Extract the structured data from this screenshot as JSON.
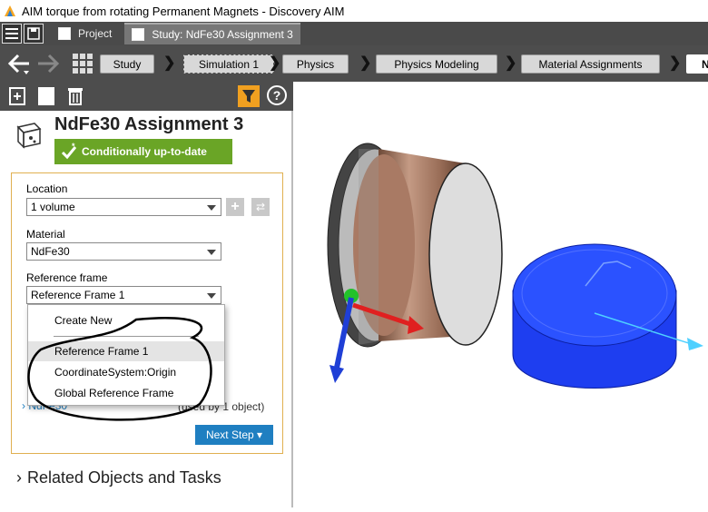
{
  "window": {
    "title": "AIM torque from rotating Permanent Magnets - Discovery AIM"
  },
  "tabs": [
    {
      "label": "Project",
      "active": false
    },
    {
      "label": "Study: NdFe30 Assignment 3",
      "active": true
    }
  ],
  "breadcrumbs": [
    {
      "label": "Study"
    },
    {
      "label": "Simulation 1"
    },
    {
      "label": "Physics"
    },
    {
      "label": "Physics Modeling"
    },
    {
      "label": "Material Assignments"
    },
    {
      "label": "N"
    }
  ],
  "panel": {
    "title": "NdFe30 Assignment 3",
    "status": "Conditionally up-to-date",
    "location_label": "Location",
    "location_value": "1 volume",
    "material_label": "Material",
    "material_value": "NdFe30",
    "refframe_label": "Reference frame",
    "refframe_value": "Reference Frame 1",
    "dropdown_options": [
      "Create New",
      "Reference Frame 1",
      "CoordinateSystem:Origin",
      "Global Reference Frame"
    ],
    "behind_link": "NdFe30",
    "behind_used": "(used by 1 object)",
    "next_step": "Next Step ▾",
    "related": "Related Objects and Tasks"
  },
  "colors": {
    "accent_status": "#6aa526",
    "next_button": "#1f7fc1",
    "filter": "#f0a020"
  }
}
